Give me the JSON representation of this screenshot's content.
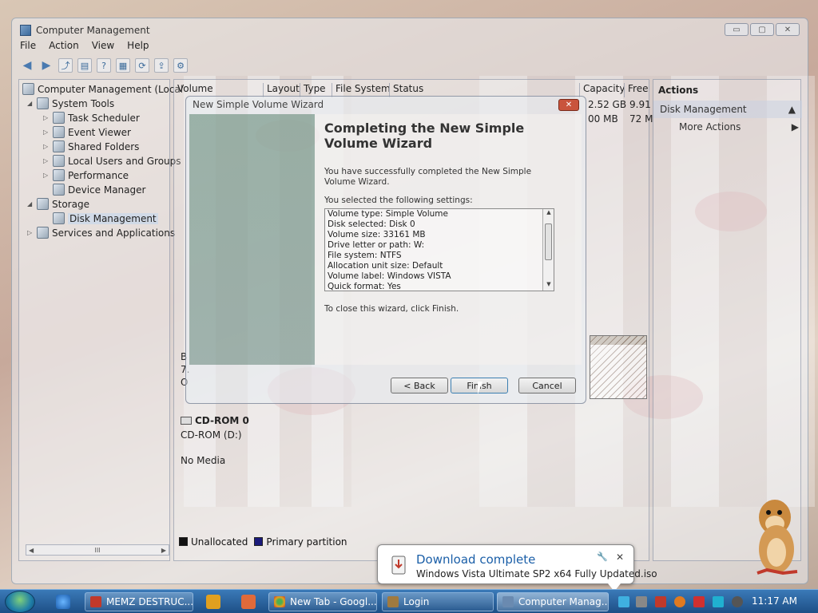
{
  "window": {
    "title": "Computer Management",
    "controls": {
      "minimize": "▭",
      "maximize": "▢",
      "close": "✕"
    }
  },
  "menu": [
    "File",
    "Action",
    "View",
    "Help"
  ],
  "tree": {
    "items": [
      {
        "label": "Computer Management (Local",
        "icon": "computer-icon"
      },
      {
        "label": "System Tools",
        "icon": "tools-icon"
      },
      {
        "label": "Task Scheduler",
        "icon": "clock-icon"
      },
      {
        "label": "Event Viewer",
        "icon": "event-viewer-icon"
      },
      {
        "label": "Shared Folders",
        "icon": "shared-folders-icon"
      },
      {
        "label": "Local Users and Groups",
        "icon": "users-icon"
      },
      {
        "label": "Performance",
        "icon": "performance-icon"
      },
      {
        "label": "Device Manager",
        "icon": "device-manager-icon"
      },
      {
        "label": "Storage",
        "icon": "storage-icon"
      },
      {
        "label": "Disk Management",
        "icon": "disk-icon"
      },
      {
        "label": "Services and Applications",
        "icon": "services-icon"
      }
    ],
    "scroll_label": "III"
  },
  "volumes": {
    "columns": [
      "Volume",
      "Layout",
      "Type",
      "File System",
      "Status",
      "Capacity",
      "Free"
    ],
    "capacity_values": [
      "2.52 GB",
      "00 MB"
    ],
    "free_values": [
      "9.91",
      "72 M"
    ],
    "disk_labels": [
      "B",
      "7.",
      "O"
    ],
    "cdrom": {
      "name": "CD-ROM 0",
      "drive": "CD-ROM (D:)",
      "media": "No Media"
    },
    "legend": [
      {
        "label": "Unallocated",
        "color": "#111111"
      },
      {
        "label": "Primary partition",
        "color": "#1a1a7a"
      }
    ]
  },
  "actions": {
    "title": "Actions",
    "section": "Disk Management",
    "item": "More Actions"
  },
  "wizard": {
    "title": "New Simple Volume Wizard",
    "heading": "Completing the New Simple Volume Wizard",
    "intro": "You have successfully completed the New Simple Volume Wizard.",
    "settings_label": "You selected the following settings:",
    "settings": [
      "Volume type: Simple Volume",
      "Disk selected: Disk 0",
      "Volume size: 33161 MB",
      "Drive letter or path: W:",
      "File system: NTFS",
      "Allocation unit size: Default",
      "Volume label: Windows VISTA",
      "Quick format: Yes"
    ],
    "close_text": "To close this wizard, click Finish.",
    "buttons": {
      "back": "< Back",
      "finish": "Finish",
      "cancel": "Cancel"
    }
  },
  "notification": {
    "title": "Download complete",
    "message": "Windows Vista Ultimate SP2 x64 Fully Updated.iso"
  },
  "taskbar": {
    "tasks": [
      {
        "label": "MEMZ DESTRUC...",
        "icon_color": "#c0392b"
      },
      {
        "label": "New Tab - Googl...",
        "icon_color": "#e0a020"
      },
      {
        "label": "Login",
        "icon_color": "#a07a40"
      },
      {
        "label": "Computer Manag...",
        "icon_color": "#6a8ab0"
      }
    ],
    "clock": "11:17 AM"
  },
  "colors": {
    "accent": "#1b5fa8",
    "taskbar": "#1d4f86"
  }
}
